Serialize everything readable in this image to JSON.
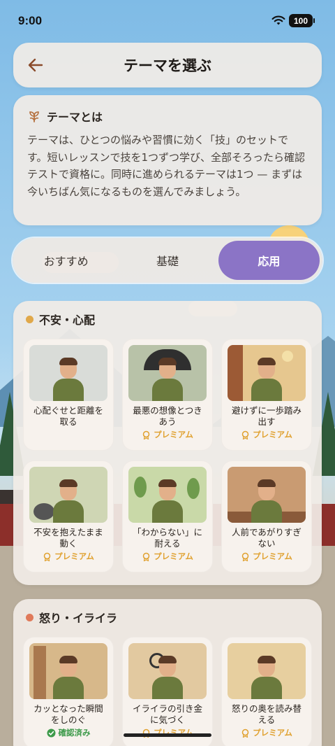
{
  "status_bar": {
    "time": "9:00",
    "battery": "100"
  },
  "header": {
    "title": "テーマを選ぶ"
  },
  "intro": {
    "title": "テーマとは",
    "body": "テーマは、ひとつの悩みや習慣に効く「技」のセットです。短いレッスンで技を1つずつ学び、全部そろったら確認テストで資格に。同時に進められるテーマは1つ — まずは今いちばん気になるものを選んでみましょう。"
  },
  "tabs": [
    {
      "label": "おすすめ",
      "active": false
    },
    {
      "label": "基礎",
      "active": false
    },
    {
      "label": "応用",
      "active": true
    }
  ],
  "sections": [
    {
      "title": "不安・心配",
      "dot_color": "#e0a84a",
      "cards": [
        {
          "label": "心配ぐせと距離を取る",
          "badge": "",
          "scene": "#d9dcd8"
        },
        {
          "label": "最悪の想像とつきあう",
          "badge": "プレミアム",
          "scene": "#b8c2a8"
        },
        {
          "label": "避けずに一歩踏み出す",
          "badge": "プレミアム",
          "scene": "#e6c78f"
        },
        {
          "label": "不安を抱えたまま動く",
          "badge": "プレミアム",
          "scene": "#cfd6b4"
        },
        {
          "label": "「わからない」に耐える",
          "badge": "プレミアム",
          "scene": "#c9d9a8"
        },
        {
          "label": "人前であがりすぎない",
          "badge": "プレミアム",
          "scene": "#c99b72"
        }
      ]
    },
    {
      "title": "怒り・イライラ",
      "dot_color": "#e07a5a",
      "cards": [
        {
          "label": "カッとなった瞬間をしのぐ",
          "badge": "確認済み",
          "scene": "#d7b88a"
        },
        {
          "label": "イライラの引き金に気づく",
          "badge": "プレミアム",
          "scene": "#e2c9a0"
        },
        {
          "label": "怒りの奥を読み替える",
          "badge": "プレミアム",
          "scene": "#e7cf9f"
        }
      ]
    }
  ],
  "colors": {
    "accent": "#8b74c6",
    "premium": "#e0a12f",
    "verified": "#3d9a4a"
  }
}
